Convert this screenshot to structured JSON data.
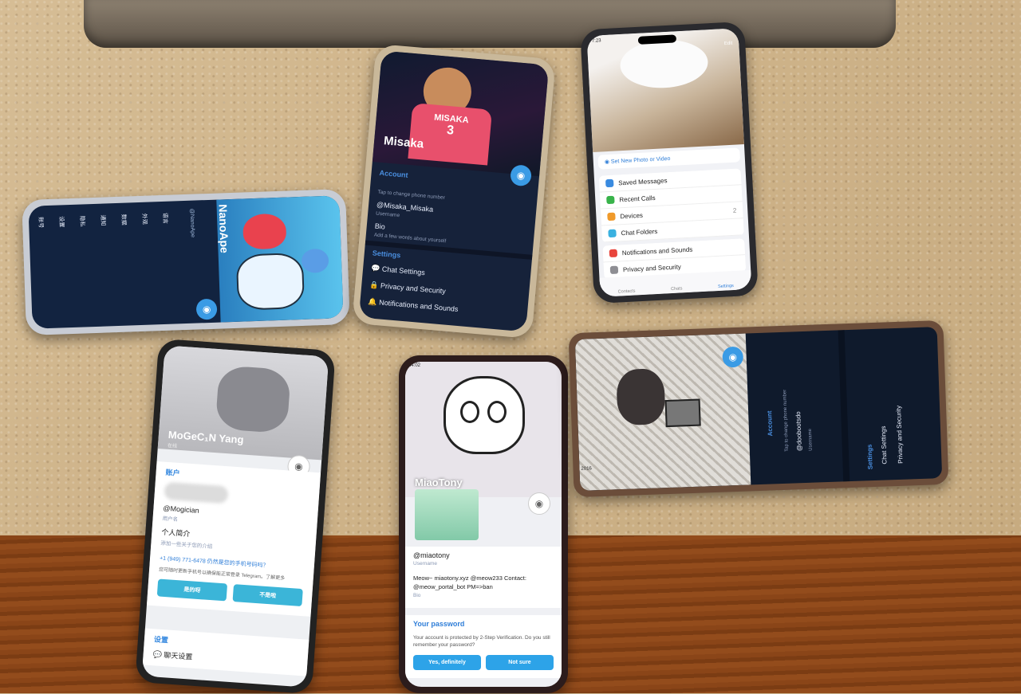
{
  "phone_misaka": {
    "name": "Misaka",
    "shirt_text": "MISAKA",
    "shirt_number": "3",
    "account_label": "Account",
    "phone_hint": "Tap to change phone number",
    "username": "@Misaka_Misaka",
    "username_label": "Username",
    "bio_label": "Bio",
    "bio_hint": "Add a few words about yourself",
    "settings_label": "Settings",
    "items": [
      "Chat Settings",
      "Privacy and Security",
      "Notifications and Sounds"
    ]
  },
  "phone_iphone": {
    "time": "7:23",
    "edit": "Edit",
    "set_photo": "Set New Photo or Video",
    "items": [
      "Saved Messages",
      "Recent Calls",
      "Devices",
      "Chat Folders"
    ],
    "devices_count": "2",
    "items2": [
      "Notifications and Sounds",
      "Privacy and Security"
    ],
    "tabs": [
      "Contacts",
      "Chats",
      "Settings"
    ],
    "icon_colors": [
      "#3a8be0",
      "#38b34a",
      "#f09a2a",
      "#3ab1e0"
    ],
    "icon_colors2": [
      "#e8453c",
      "#8e8e93"
    ]
  },
  "phone_nanoape": {
    "name": "NanoApe",
    "handle": "@NanoApe",
    "side_items": [
      "账号",
      "设置",
      "隐私",
      "通知",
      "数据",
      "外观",
      "语言"
    ]
  },
  "phone_fold": {
    "name": "MoGeC₁N Yang",
    "status": "在线",
    "account_label": "账户",
    "username": "@Mogician",
    "username_label": "用户名",
    "bio_label": "个人简介",
    "bio_hint": "添加一些关于您的介绍",
    "phone_notice": "+1 (949) 771-6478 仍然是您的手机号码吗？",
    "notice_sub": "您可随时更新手机号以确保能正常登录 Telegram。了解更多",
    "btn_yes": "是的呀",
    "btn_no": "不是啦",
    "settings_label": "设置",
    "chat_settings": "聊天设置"
  },
  "phone_miao": {
    "time": "14:02",
    "name": "MiaoTony",
    "username": "@miaotony",
    "username_label": "Username",
    "bio": "Meow~ miaotony.xyz @meow233 Contact: @meow_portal_bot PM=>ban",
    "bio_label": "Bio",
    "password_title": "Your password",
    "password_text": "Your account is protected by 2-Step Verification. Do you still remember your password?",
    "btn_yes": "Yes, definitely",
    "btn_no": "Not sure"
  },
  "phone_manga": {
    "account_label": "Account",
    "phone_hint": "Tap to change phone number",
    "username": "@doobootsdo",
    "username_label": "Username",
    "settings_label": "Settings",
    "items": [
      "Chat Settings",
      "Privacy and Security"
    ],
    "year_text": "2016"
  }
}
